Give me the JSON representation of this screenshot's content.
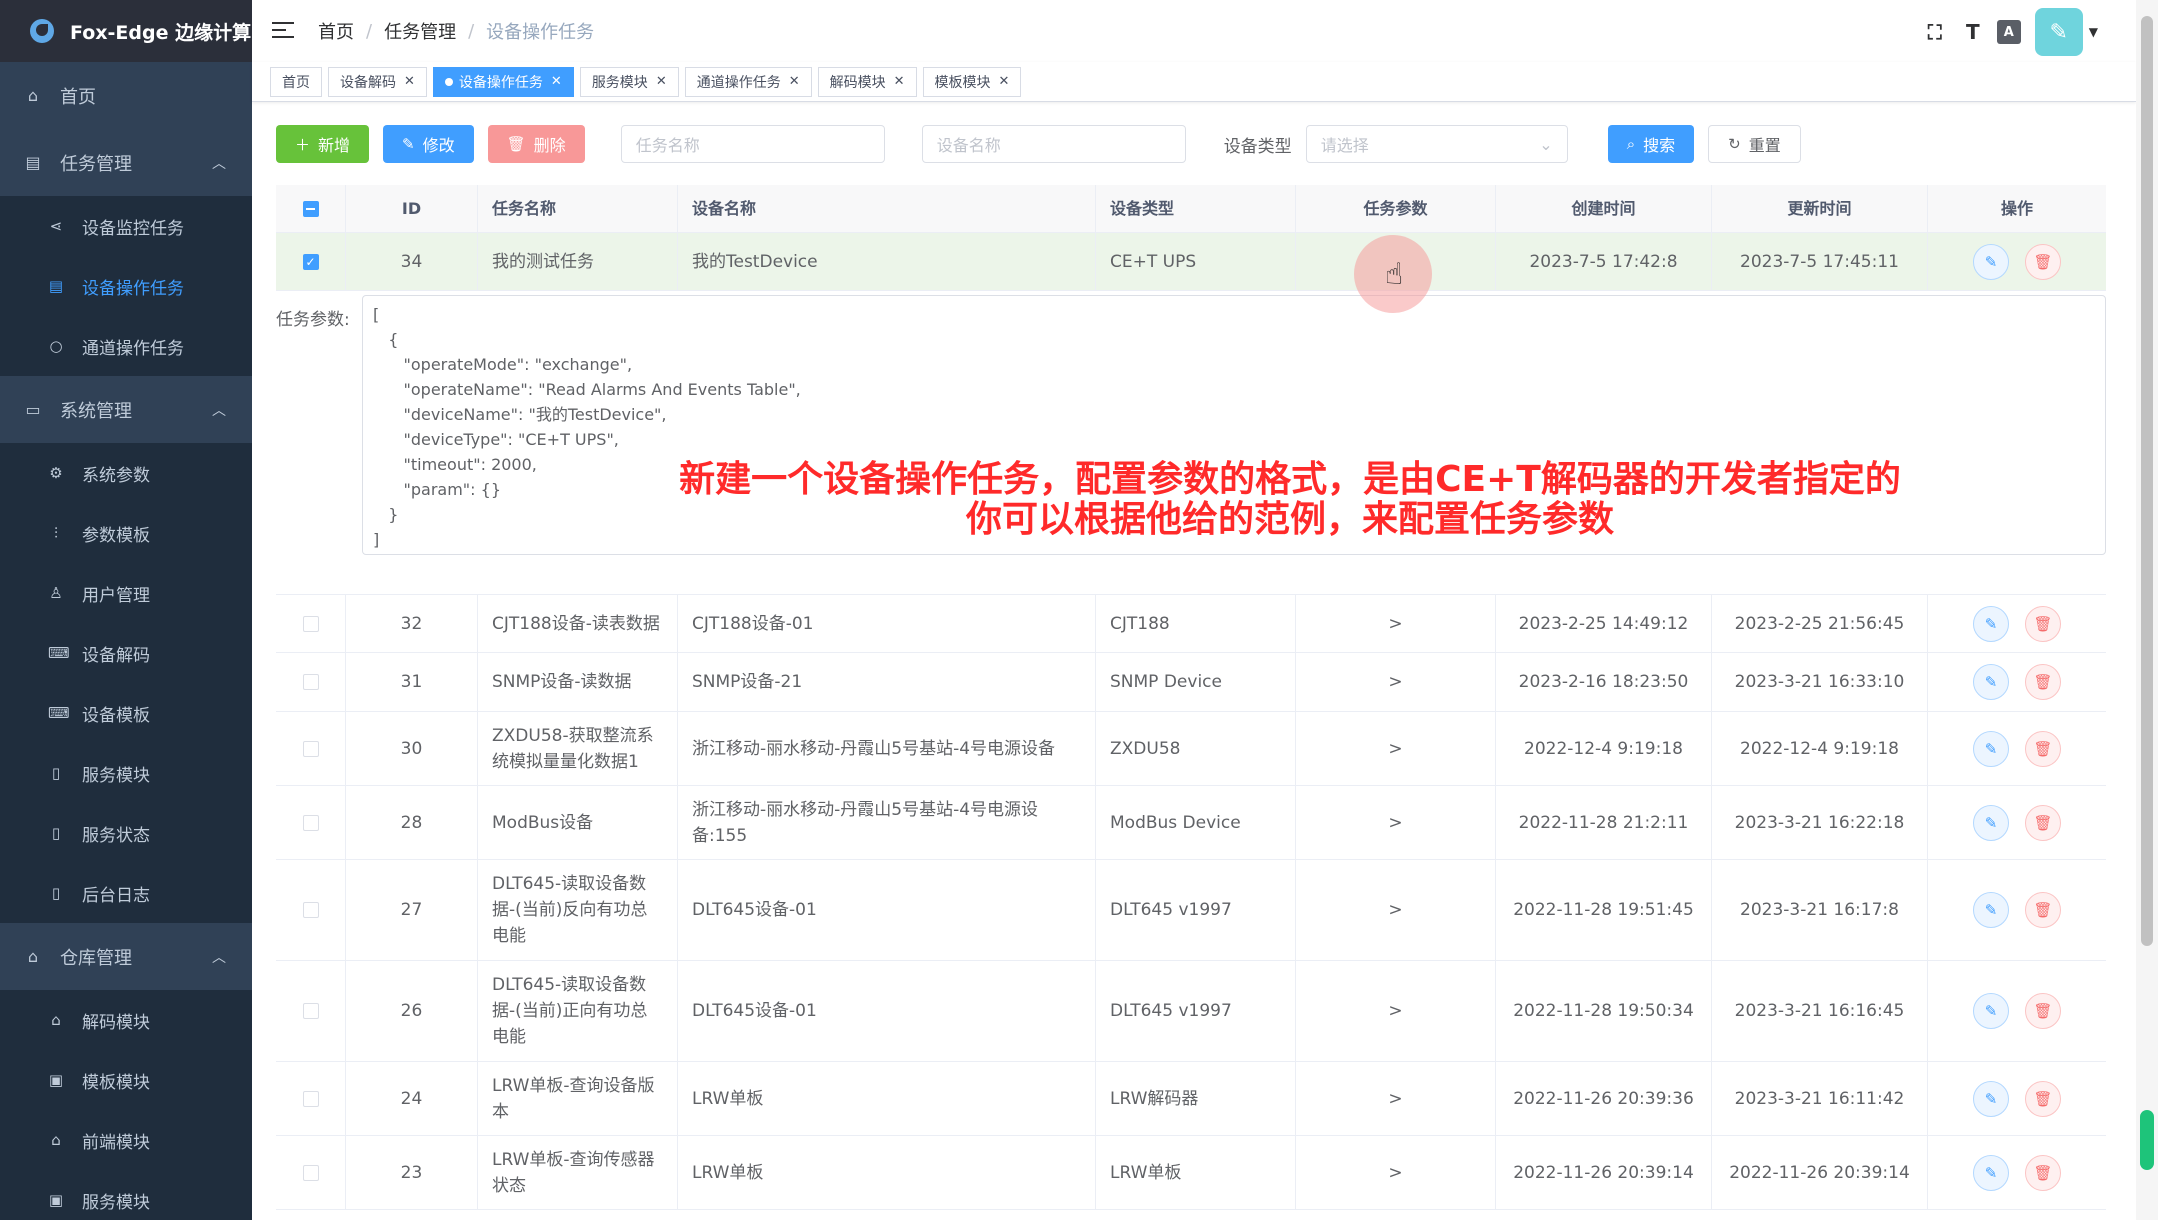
{
  "app": {
    "title": "Fox-Edge 边缘计算"
  },
  "sidebar": {
    "home": "首页",
    "groups": [
      {
        "label": "任务管理",
        "items": [
          "设备监控任务",
          "设备操作任务",
          "通道操作任务"
        ]
      },
      {
        "label": "系统管理",
        "items": [
          "系统参数",
          "参数模板",
          "用户管理",
          "设备解码",
          "设备模板",
          "服务模块",
          "服务状态",
          "后台日志"
        ]
      },
      {
        "label": "仓库管理",
        "items": [
          "解码模块",
          "模板模块",
          "前端模块",
          "服务模块"
        ]
      }
    ],
    "active_item": "设备操作任务"
  },
  "breadcrumb": [
    "首页",
    "任务管理",
    "设备操作任务"
  ],
  "tags": [
    "首页",
    "设备解码",
    "设备操作任务",
    "服务模块",
    "通道操作任务",
    "解码模块",
    "模板模块"
  ],
  "active_tag": "设备操作任务",
  "toolbar": {
    "add": "新增",
    "edit": "修改",
    "delete": "删除",
    "task_name_placeholder": "任务名称",
    "device_name_placeholder": "设备名称",
    "device_type_label": "设备类型",
    "device_type_placeholder": "请选择",
    "search": "搜索",
    "reset": "重置"
  },
  "table": {
    "headers": [
      "ID",
      "任务名称",
      "设备名称",
      "设备类型",
      "任务参数",
      "创建时间",
      "更新时间",
      "操作"
    ],
    "expanded_label": "任务参数:",
    "expanded_json": "[\n   {\n      \"operateMode\": \"exchange\",\n      \"operateName\": \"Read Alarms And Events Table\",\n      \"deviceName\": \"我的TestDevice\",\n      \"deviceType\": \"CE+T UPS\",\n      \"timeout\": 2000,\n      \"param\": {}\n   }\n]",
    "rows": [
      {
        "id": "34",
        "name": "我的测试任务",
        "device": "我的TestDevice",
        "type": "CE+T UPS",
        "param": "",
        "created": "2023-7-5 17:42:8",
        "updated": "2023-7-5 17:45:11",
        "selected": true
      },
      {
        "id": "32",
        "name": "CJT188设备-读表数据",
        "device": "CJT188设备-01",
        "type": "CJT188",
        "param": ">",
        "created": "2023-2-25 14:49:12",
        "updated": "2023-2-25 21:56:45"
      },
      {
        "id": "31",
        "name": "SNMP设备-读数据",
        "device": "SNMP设备-21",
        "type": "SNMP Device",
        "param": ">",
        "created": "2023-2-16 18:23:50",
        "updated": "2023-3-21 16:33:10"
      },
      {
        "id": "30",
        "name": "ZXDU58-获取整流系统模拟量量化数据1",
        "device": "浙江移动-丽水移动-丹霞山5号基站-4号电源设备",
        "type": "ZXDU58",
        "param": ">",
        "created": "2022-12-4 9:19:18",
        "updated": "2022-12-4 9:19:18"
      },
      {
        "id": "28",
        "name": "ModBus设备",
        "device": "浙江移动-丽水移动-丹霞山5号基站-4号电源设备:155",
        "type": "ModBus Device",
        "param": ">",
        "created": "2022-11-28 21:2:11",
        "updated": "2023-3-21 16:22:18"
      },
      {
        "id": "27",
        "name": "DLT645-读取设备数据-(当前)反向有功总电能",
        "device": "DLT645设备-01",
        "type": "DLT645 v1997",
        "param": ">",
        "created": "2022-11-28 19:51:45",
        "updated": "2023-3-21 16:17:8"
      },
      {
        "id": "26",
        "name": "DLT645-读取设备数据-(当前)正向有功总电能",
        "device": "DLT645设备-01",
        "type": "DLT645 v1997",
        "param": ">",
        "created": "2022-11-28 19:50:34",
        "updated": "2023-3-21 16:16:45"
      },
      {
        "id": "24",
        "name": "LRW单板-查询设备版本",
        "device": "LRW单板",
        "type": "LRW解码器",
        "param": ">",
        "created": "2022-11-26 20:39:36",
        "updated": "2023-3-21 16:11:42"
      },
      {
        "id": "23",
        "name": "LRW单板-查询传感器状态",
        "device": "LRW单板",
        "type": "LRW单板",
        "param": ">",
        "created": "2022-11-26 20:39:14",
        "updated": "2022-11-26 20:39:14"
      }
    ]
  },
  "subtitle": {
    "line1": "新建一个设备操作任务，配置参数的格式，是由CE+T解码器的开发者指定的",
    "line2": "你可以根据他给的范例，来配置任务参数"
  },
  "colors": {
    "sidebar": "#304156",
    "accent": "#409eff",
    "add": "#67c23a",
    "delete": "#f89898",
    "subtitle": "#ff2a2a"
  }
}
